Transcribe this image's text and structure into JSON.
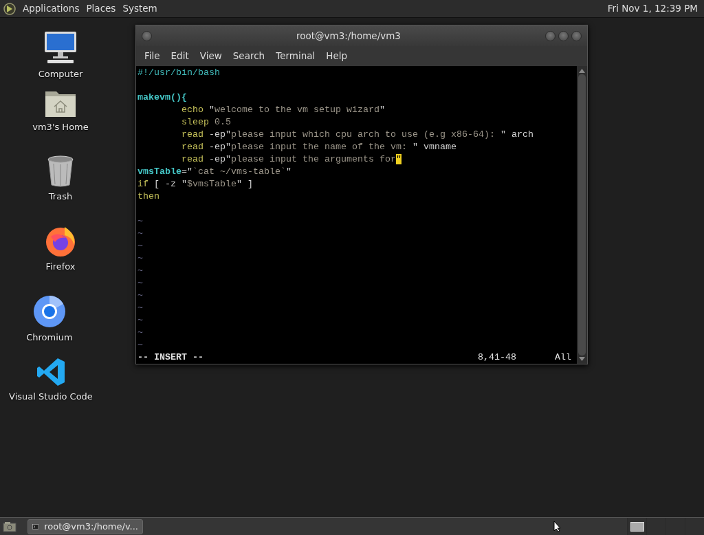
{
  "top_panel": {
    "menus": [
      "Applications",
      "Places",
      "System"
    ],
    "clock": "Fri Nov 1, 12:39 PM"
  },
  "desktop_icons": [
    {
      "label": "Computer",
      "kind": "computer"
    },
    {
      "label": "vm3's Home",
      "kind": "home"
    },
    {
      "label": "Trash",
      "kind": "trash"
    },
    {
      "label": "Firefox",
      "kind": "firefox"
    },
    {
      "label": "Chromium",
      "kind": "chromium"
    },
    {
      "label": "Visual Studio Code",
      "kind": "vscode"
    }
  ],
  "terminal": {
    "title": "root@vm3:/home/vm3",
    "menu": [
      "File",
      "Edit",
      "View",
      "Search",
      "Terminal",
      "Help"
    ],
    "lines": [
      {
        "kind": "code",
        "indent": false,
        "segments": [
          {
            "text": "#!/usr/bin/bash",
            "kind": "comment"
          }
        ]
      },
      {
        "kind": "blank"
      },
      {
        "kind": "code",
        "indent": false,
        "segments": [
          {
            "text": "makevm(){",
            "kind": "func"
          }
        ]
      },
      {
        "kind": "code",
        "indent": true,
        "segments": [
          {
            "text": "echo",
            "kind": "keyword"
          },
          {
            "text": " \"",
            "kind": "plain"
          },
          {
            "text": "welcome to the vm setup wizard",
            "kind": "string"
          },
          {
            "text": "\"",
            "kind": "plain"
          }
        ]
      },
      {
        "kind": "code",
        "indent": true,
        "segments": [
          {
            "text": "sleep",
            "kind": "keyword"
          },
          {
            "text": "0.5",
            "kind": "string",
            "gap": true
          }
        ]
      },
      {
        "kind": "code",
        "indent": true,
        "segments": [
          {
            "text": "read",
            "kind": "keyword"
          },
          {
            "text": " -ep\"",
            "kind": "plain"
          },
          {
            "text": "please input which cpu arch to use (e.g x86-64): ",
            "kind": "string"
          },
          {
            "text": "\" arch",
            "kind": "plain"
          }
        ]
      },
      {
        "kind": "code",
        "indent": true,
        "segments": [
          {
            "text": "read",
            "kind": "keyword"
          },
          {
            "text": " -ep\"",
            "kind": "plain"
          },
          {
            "text": "please input the name of the vm: ",
            "kind": "string"
          },
          {
            "text": "\" vmname",
            "kind": "plain"
          }
        ]
      },
      {
        "kind": "code",
        "indent": true,
        "segments": [
          {
            "text": "read",
            "kind": "keyword"
          },
          {
            "text": " -ep\"",
            "kind": "plain"
          },
          {
            "text": "please input the arguments for",
            "kind": "string"
          },
          {
            "text": "\"",
            "kind": "cursor"
          }
        ]
      },
      {
        "kind": "code",
        "indent": false,
        "segments": [
          {
            "text": "vmsTable",
            "kind": "func"
          },
          {
            "text": "=\"",
            "kind": "plain"
          },
          {
            "text": "`cat ~/vms-table`",
            "kind": "string"
          },
          {
            "text": "\"",
            "kind": "plain"
          }
        ]
      },
      {
        "kind": "code",
        "indent": false,
        "segments": [
          {
            "text": "if",
            "kind": "keyword"
          },
          {
            "text": " [ -z \"",
            "kind": "plain"
          },
          {
            "text": "$vmsTable",
            "kind": "string"
          },
          {
            "text": "\" ]",
            "kind": "plain"
          }
        ]
      },
      {
        "kind": "code",
        "indent": false,
        "segments": [
          {
            "text": "then",
            "kind": "keyword"
          }
        ]
      },
      {
        "kind": "blank"
      }
    ],
    "tildes": [
      "~",
      "~",
      "~",
      "~",
      "~",
      "~",
      "~",
      "~",
      "~",
      "~",
      "~"
    ],
    "status": {
      "mode": "-- INSERT --",
      "position": "8,41-48",
      "scroll": "All"
    }
  },
  "taskbar": {
    "tasks": [
      {
        "label": "root@vm3:/home/v...",
        "selected": false
      }
    ]
  }
}
